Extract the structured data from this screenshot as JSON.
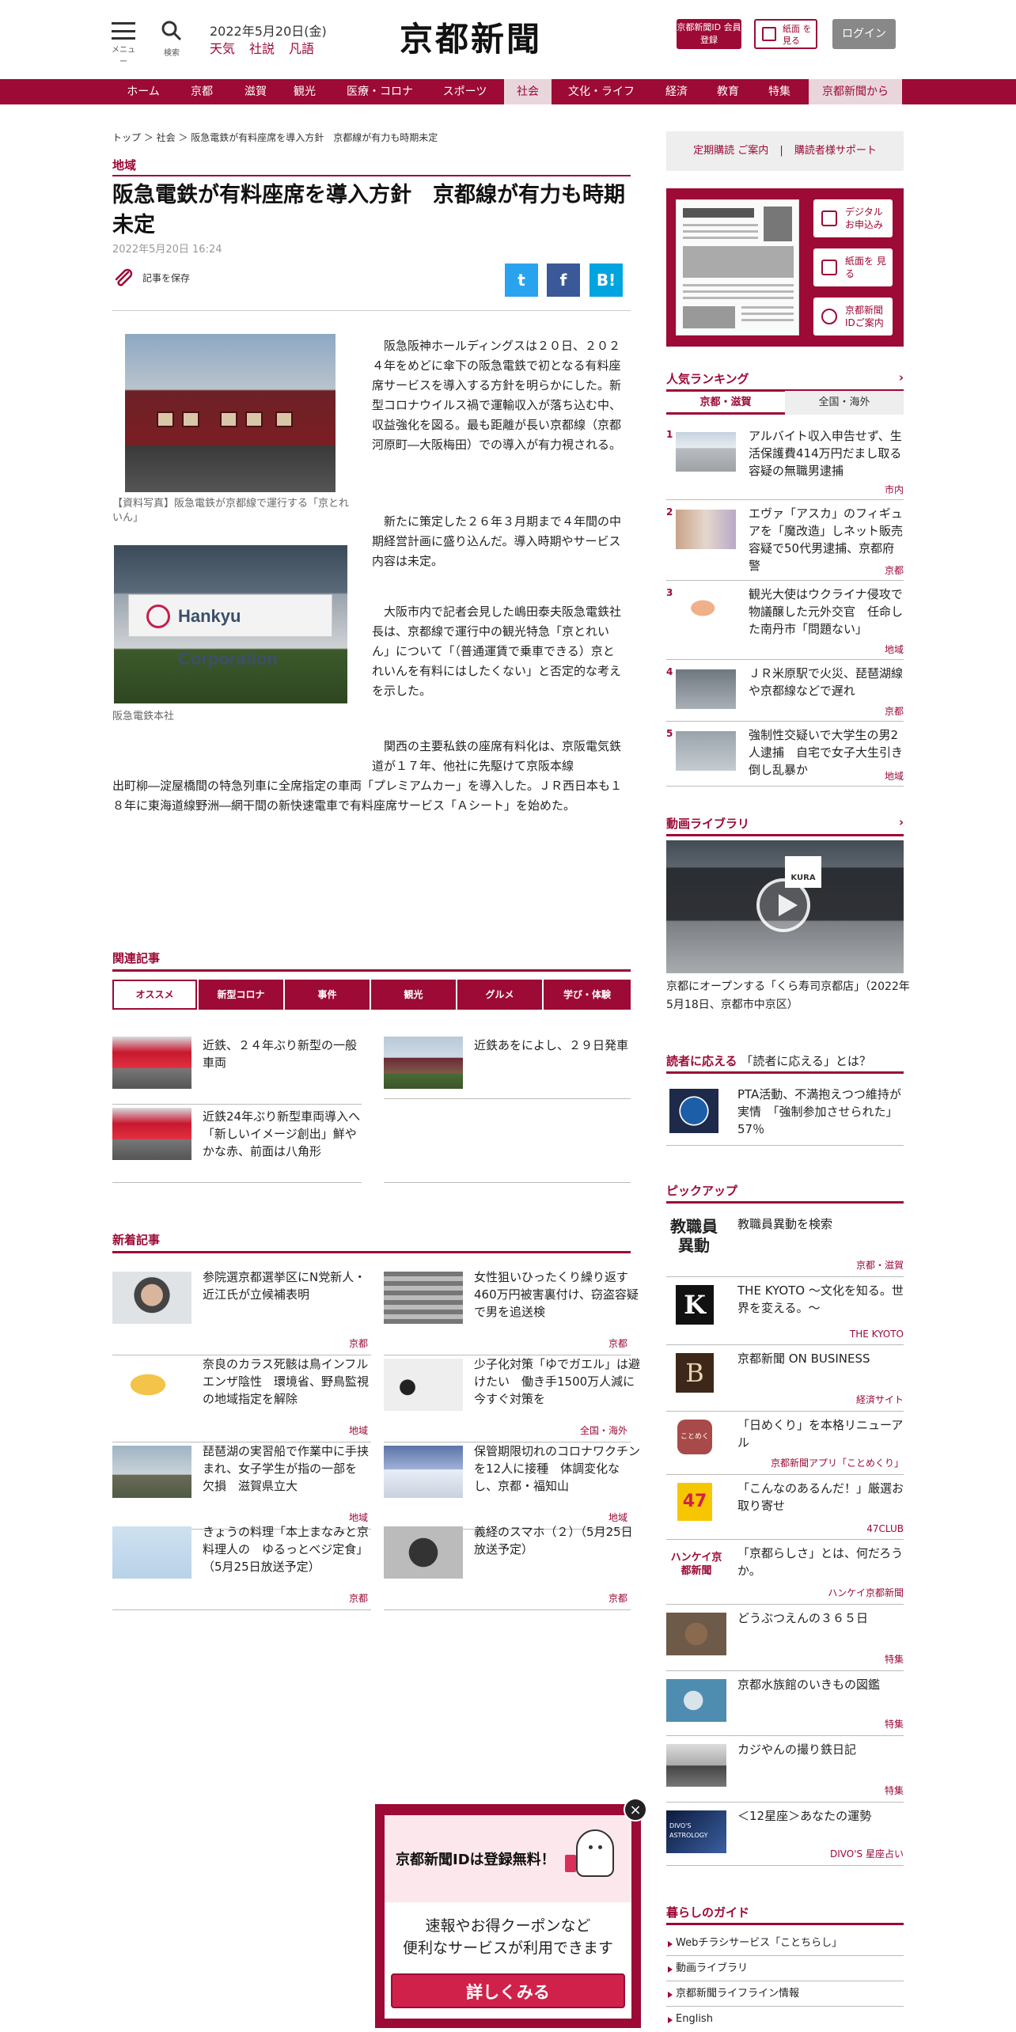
{
  "header": {
    "menu_label": "メニュー",
    "search_label": "検索",
    "date": "2022年5月20日(金)",
    "weather": "天気",
    "editorial": "社説",
    "fuuyu": "凡語",
    "logo": "京都新聞",
    "id_button": "京都新聞ID 会員登録",
    "paper_button": "紙面 を見る",
    "login_button": "ログイン"
  },
  "nav": [
    {
      "label": "ホーム"
    },
    {
      "label": "京都"
    },
    {
      "label": "滋賀"
    },
    {
      "label": "観光"
    },
    {
      "label": "医療・コロナ"
    },
    {
      "label": "スポーツ"
    },
    {
      "label": "社会"
    },
    {
      "label": "文化・ライフ"
    },
    {
      "label": "経済"
    },
    {
      "label": "教育"
    },
    {
      "label": "特集"
    },
    {
      "label": "京都新聞から"
    }
  ],
  "article": {
    "breadcrumb": "トップ ＞ 社会 ＞ 阪急電鉄が有料座席を導入方針　京都線が有力も時期未定",
    "category": "地域",
    "title": "阪急電鉄が有料座席を導入方針　京都線が有力も時期未定",
    "date": "2022年5月20日 16:24",
    "save_label": "記事を保存",
    "share": {
      "twitter": "t",
      "facebook": "f",
      "hatena": "B!"
    },
    "caption1": "【資料写真】阪急電鉄が京都線で運行する「京とれいん」",
    "caption2": "阪急電鉄本社",
    "sign_text": "Hankyu Corporation",
    "p1": "　阪急阪神ホールディングスは２０日、２０２４年をめどに傘下の阪急電鉄で初となる有料座席サービスを導入する方針を明らかにした。新型コロナウイルス禍で運輸収入が落ち込む中、収益強化を図る。最も距離が長い京都線（京都河原町―大阪梅田）での導入が有力視される。",
    "p2": "　新たに策定した２６年３月期まで４年間の中期経営計画に盛り込んだ。導入時期やサービス内容は未定。",
    "p3": "　大阪市内で記者会見した嶋田泰夫阪急電鉄社長は、京都線で運行中の観光特急「京とれいん」について「（普通運賃で乗車できる）京とれいんを有料にはしたくない」と否定的な考えを示した。",
    "p4a": "　関西の主要私鉄の座席有料化は、京阪電気鉄道が１７年、他社に先駆けて京阪本線",
    "p4b": "出町柳―淀屋橋間の特急列車に全席指定の車両「プレミアムカー」を導入した。ＪＲ西日本も１８年に東海道線野洲―網干間の新快速電車で有料座席サービス「Ａシート」を始めた。"
  },
  "related": {
    "heading": "関連記事",
    "tabs": [
      "オススメ",
      "新型コロナ",
      "事件",
      "観光",
      "グルメ",
      "学び・体験"
    ],
    "items": [
      {
        "text": "近鉄、２４年ぶり新型の一般車両"
      },
      {
        "text": "近鉄あをによし、２９日発車"
      },
      {
        "text": "近鉄24年ぶり新型車両導入へ「新しいイメージ創出」鮮やかな赤、前面は八角形"
      }
    ]
  },
  "latest": {
    "heading": "新着記事",
    "items": [
      {
        "text": "参院選京都選挙区にN党新人・近江氏が立候補表明",
        "area": "京都"
      },
      {
        "text": "女性狙いひったくり繰り返す　460万円被害裏付け、窃盗容疑で男を追送検",
        "area": "京都"
      },
      {
        "text": "奈良のカラス死骸は鳥インフルエンザ陰性　環境省、野鳥監視の地域指定を解除",
        "area": "地域"
      },
      {
        "text": "少子化対策「ゆでガエル」は避けたい　働き手1500万人減に今すぐ対策を",
        "area": "全国・海外"
      },
      {
        "text": "琵琶湖の実習船で作業中に手挟まれ、女子学生が指の一部を欠損　滋賀県立大",
        "area": "地域"
      },
      {
        "text": "保管期限切れのコロナワクチンを12人に接種　体調変化なし、京都・福知山",
        "area": "地域"
      },
      {
        "text": "きょうの料理「本上まなみと京料理人の　ゆるっとべジ定食」（5月25日放送予定）",
        "area": "京都"
      },
      {
        "text": "義経のスマホ（２）（5月25日放送予定）",
        "area": "京都"
      }
    ]
  },
  "sidebar": {
    "support_left": "定期購読 ご案内",
    "support_sep": "|",
    "support_right": "購読者様サポート",
    "paper_buttons": [
      "デジタル お申込み",
      "紙面を 見る",
      "京都新聞 IDご案内"
    ],
    "ranking_heading": "人気ランキング",
    "ranking_tabs": [
      "京都・滋賀",
      "全国・海外"
    ],
    "ranking": [
      {
        "no": "1",
        "text": "アルバイト収入申告せず、生活保護費414万円だまし取る　容疑の無職男逮捕",
        "area": "市内"
      },
      {
        "no": "2",
        "text": "エヴァ「アスカ」のフィギュアを「魔改造」しネット販売　容疑で50代男逮捕、京都府警",
        "area": "京都"
      },
      {
        "no": "3",
        "text": "観光大使はウクライナ侵攻で物議醸した元外交官　任命した南丹市「問題ない」",
        "area": "地域"
      },
      {
        "no": "4",
        "text": "ＪＲ米原駅で火災、琵琶湖線や京都線などで遅れ",
        "area": "京都"
      },
      {
        "no": "5",
        "text": "強制性交疑いで大学生の男2人逮捕　自宅で女子大生引き倒し乱暴か",
        "area": "地域"
      }
    ],
    "video_heading": "動画ライブラリ",
    "video_caption": "京都にオープンする「くら寿司京都店」（2022年5月18日、京都市中京区）",
    "video_sign": "KURA",
    "reader_heading": "読者に応える",
    "reader_sub": "「読者に応える」とは？",
    "reader_item": "PTA活動、不満抱えつつ維持が実情　「強制参加させられた」57％",
    "pickup_heading": "ピックアップ",
    "pickup": [
      {
        "logo": "教職員異動",
        "text": "教職員異動を検索",
        "sub": "京都・滋賀"
      },
      {
        "logo": "K",
        "text": "THE KYOTO ～文化を知る。世界を変える。～",
        "sub": "THE KYOTO"
      },
      {
        "logo": "B",
        "text": "京都新聞 ON BUSINESS",
        "sub": "経済サイト"
      },
      {
        "logo": "ことめくり",
        "text": "「日めくり」を本格リニューアル",
        "sub": "京都新聞アプリ「ことめくり」"
      },
      {
        "logo": "47",
        "text": "「こんなのあるんだ！」厳選お取り寄せ",
        "sub": "47CLUB"
      },
      {
        "logo": "ハンケイ京都新聞",
        "text": "「京都らしさ」とは、何だろうか。",
        "sub": "ハンケイ京都新聞"
      },
      {
        "logo": "",
        "text": "どうぶつえんの３６５日",
        "sub": "特集"
      },
      {
        "logo": "",
        "text": "京都水族館のいきもの図鑑",
        "sub": "特集"
      },
      {
        "logo": "",
        "text": "カジやんの撮り鉄日記",
        "sub": "特集"
      },
      {
        "logo": "DIVO'S ASTROLOGY",
        "text": "＜12星座＞あなたの運勢",
        "sub": "DIVO'S 星座占い"
      }
    ],
    "guide_heading": "暮らしのガイド",
    "guide": [
      "Webチラシサービス「ことちらし」",
      "動画ライブラリ",
      "京都新聞ライフライン情報",
      "English"
    ]
  },
  "popup": {
    "title": "京都新聞IDは登録無料！",
    "desc1": "速報やお得クーポンなど",
    "desc2": "便利なサービスが利用できます",
    "cta": "詳しくみる",
    "close": "×"
  },
  "colors": {
    "brand": "#9c0a35",
    "accent_pink": "#d0214b"
  }
}
